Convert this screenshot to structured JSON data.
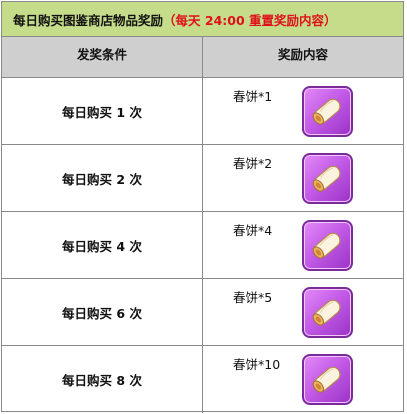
{
  "title": {
    "main": "每日购买图鉴商店物品奖励",
    "note": "（每天 24:00 重置奖励内容）"
  },
  "header": {
    "condition": "发奖条件",
    "reward": "奖励内容"
  },
  "rows": [
    {
      "condition": "每日购买 1 次",
      "reward": "春饼*1",
      "icon": "spring-roll-icon"
    },
    {
      "condition": "每日购买 2 次",
      "reward": "春饼*2",
      "icon": "spring-roll-icon"
    },
    {
      "condition": "每日购买 4 次",
      "reward": "春饼*4",
      "icon": "spring-roll-icon"
    },
    {
      "condition": "每日购买 6 次",
      "reward": "春饼*5",
      "icon": "spring-roll-icon"
    },
    {
      "condition": "每日购买 8 次",
      "reward": "春饼*10",
      "icon": "spring-roll-icon"
    }
  ],
  "colors": {
    "title_bg": "#c5dd8b",
    "header_bg": "#cfcfcf",
    "note_red": "#e0101a",
    "item_frame": "#c45ce8"
  }
}
